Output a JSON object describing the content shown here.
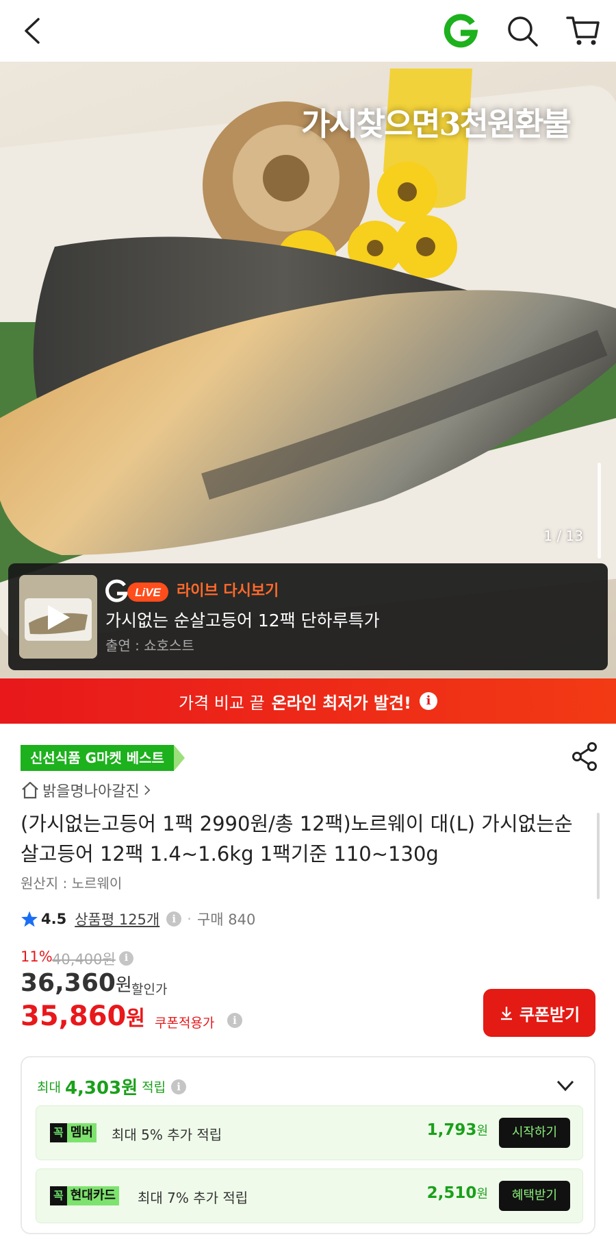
{
  "nav": {
    "back_icon": "chevron-left-icon",
    "logo_icon": "gmarket-g-logo",
    "search_icon": "search-icon",
    "cart_icon": "cart-icon"
  },
  "hero": {
    "watermark": "가시찾으면3천원환불",
    "counter": "1 / 13"
  },
  "live": {
    "badge": "LiVE",
    "label": "라이브 다시보기",
    "title": "가시없는 순살고등어 12팩 단하루특가",
    "cast": "출연 : 쇼호스트"
  },
  "banner": {
    "text": "가격 비교 끝",
    "strong": "온라인 최저가 발견!",
    "info": "i"
  },
  "product": {
    "badge": "신선식품 G마켓 베스트",
    "store": "밝을명나아갈진",
    "title": "(가시없는고등어 1팩 2990원/총 12팩)노르웨이 대(L) 가시없는순살고등어 12팩 1.4~1.6kg 1팩기준 110~130g",
    "origin": "원산지 : 노르웨이",
    "rating": "4.5",
    "reviews": "상품평 125개",
    "buys": "구매 840"
  },
  "price": {
    "discount": "11%",
    "original": "40,400원",
    "sale": "36,360",
    "sale_unit": "원",
    "sale_label": "할인가",
    "coupon": "35,860",
    "coupon_unit": "원",
    "coupon_label": "쿠폰적용가",
    "coupon_button": "쿠폰받기"
  },
  "points": {
    "prefix": "최대",
    "amount": "4,303원",
    "suffix": "적립",
    "rows": [
      {
        "k": "꼭",
        "name": "멤버",
        "desc": "최대 5% 추가 적립",
        "amount": "1,793",
        "unit": "원",
        "action": "시작하기"
      },
      {
        "k": "꼭",
        "name": "현대카드",
        "desc": "최대 7% 추가 적립",
        "amount": "2,510",
        "unit": "원",
        "action": "혜택받기"
      }
    ]
  },
  "colors": {
    "accent_red": "#e8181b",
    "accent_green": "#1db11d",
    "live_orange": "#ff6a2a"
  }
}
